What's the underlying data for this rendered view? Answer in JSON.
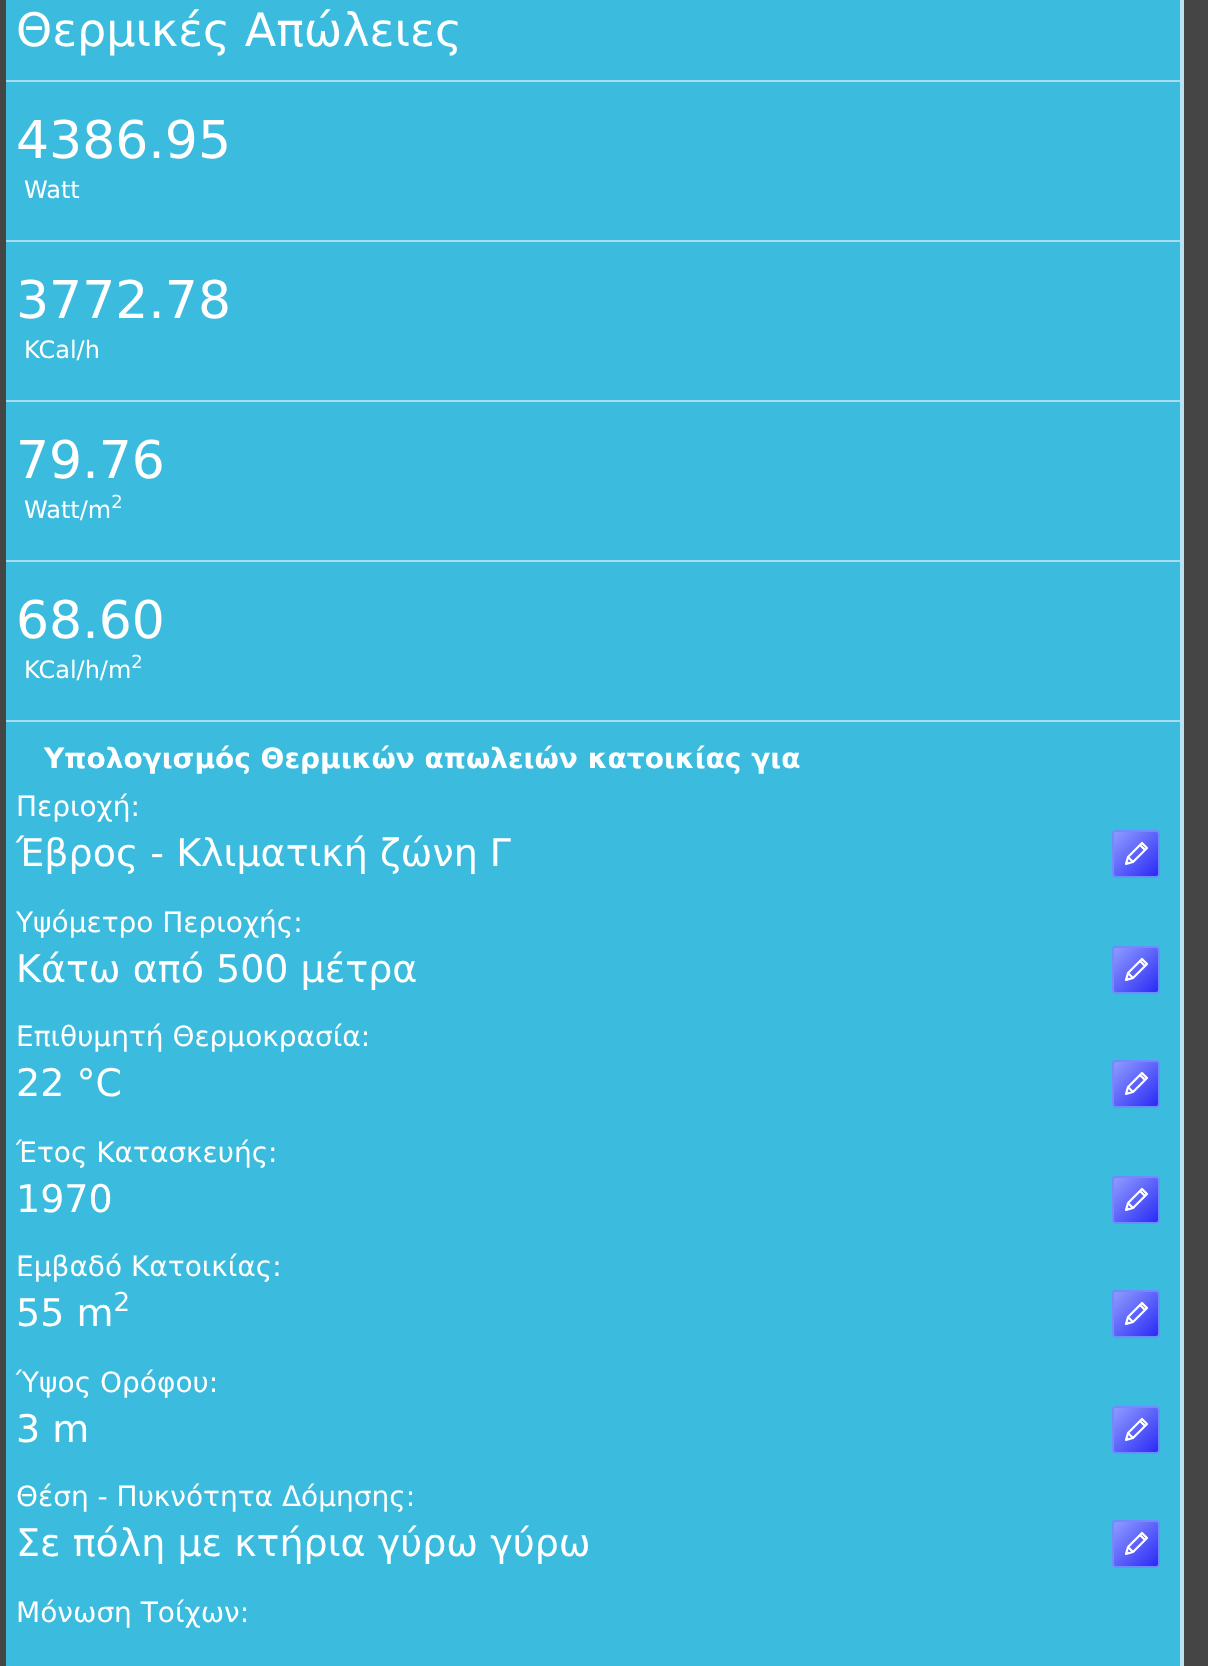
{
  "title": "Θερμικές Απώλειες",
  "results": [
    {
      "value": "4386.95",
      "unit": "Watt"
    },
    {
      "value": "3772.78",
      "unit": "KCal/h"
    },
    {
      "value": "79.76",
      "unit": "Watt/m$^{2}$"
    },
    {
      "value": "68.60",
      "unit": "KCal/h/m$^{2}$"
    }
  ],
  "section_heading": "Υπολογισμός Θερμικών απωλειών κατοικίας για",
  "parameters": [
    {
      "label": "Περιοχή:",
      "value": "Έβρος - Κλιματική ζώνη Γ"
    },
    {
      "label": "Υψόμετρο Περιοχής:",
      "value": "Κάτω από 500 μέτρα"
    },
    {
      "label": "Επιθυμητή Θερμοκρασία:",
      "value": "22 °C"
    },
    {
      "label": "Έτος Κατασκευής:",
      "value": "1970"
    },
    {
      "label": "Εμβαδό Κατοικίας:",
      "value": "55 m$^{2}$"
    },
    {
      "label": "Ύψος Ορόφου:",
      "value": "3 m"
    },
    {
      "label": "Θέση - Πυκνότητα Δόμησης:",
      "value": "Σε πόλη με κτήρια γύρω γύρω"
    },
    {
      "label": "Μόνωση Τοίχων:"
    }
  ]
}
